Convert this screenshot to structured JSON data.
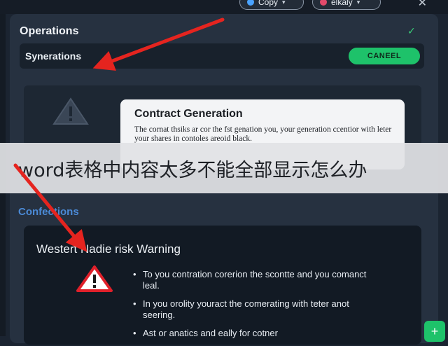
{
  "toolbar": {
    "copy_label": "Copy",
    "user_label": "elkaly",
    "copy_icon_color": "#4aa3ff",
    "user_icon_color": "#e24a6b"
  },
  "operations": {
    "title": "Operations",
    "subbar_label": "Synerations",
    "cancel_label": "CANEEL"
  },
  "dialog": {
    "title": "Contract Generation",
    "body": "The cornat thsiks ar cor the fst genation you, your generation ccentior with leter your shares in contoles areoid black."
  },
  "banner": {
    "text": "word表格中内容太多不能全部显示怎么办"
  },
  "section": {
    "title": "Confections"
  },
  "warning_card": {
    "title": "Westert Nadie risk Warning",
    "bullets": [
      "To you contration corerion the scontte and you comanct leal.",
      "In you orolity youract the comerating with teter anot seering.",
      "Ast or anatics and eally for cotner"
    ]
  },
  "colors": {
    "background": "#1b2431",
    "panel": "#263140",
    "accent_green": "#1ec26a",
    "accent_blue": "#4b8ad6",
    "arrow_red": "#e5241f"
  }
}
